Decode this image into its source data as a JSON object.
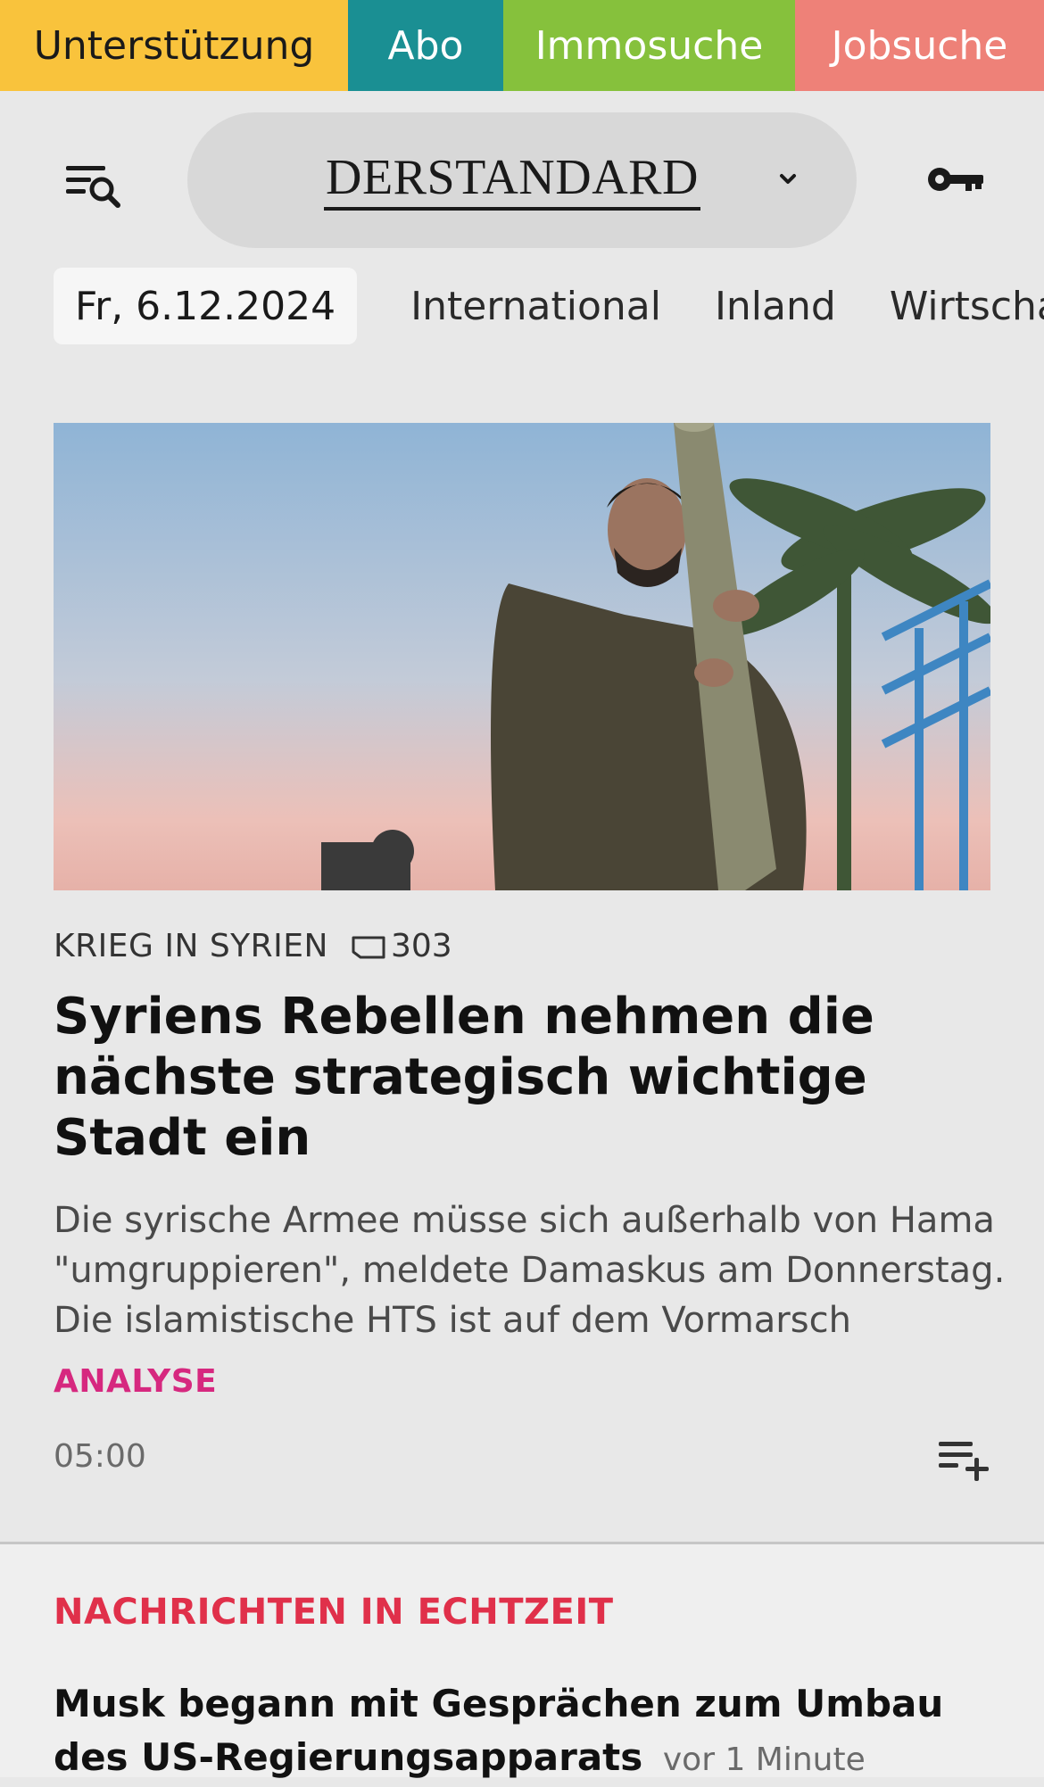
{
  "topbar": {
    "support": "Unterstützung",
    "abo": "Abo",
    "immo": "Immosuche",
    "jobs": "Jobsuche"
  },
  "header": {
    "brand": "DERSTANDARD",
    "menu_icon": "menu-search-icon",
    "chevron_icon": "chevron-down-icon",
    "login_icon": "key-icon"
  },
  "nav": {
    "date": "Fr, 6.12.2024",
    "sections": [
      "International",
      "Inland",
      "Wirtschaft"
    ]
  },
  "article": {
    "kicker": "KRIEG IN SYRIEN",
    "comments": "303",
    "headline": "Syriens Rebellen nehmen die nächste strategisch wichtige Stadt ein",
    "teaser": "Die syrische Armee müsse sich außerhalb von Hama \"umgruppieren\", meldete Damaskus am Donnerstag. Die islamistische HTS ist auf dem Vormarsch",
    "label": "ANALYSE",
    "time": "05:00"
  },
  "live": {
    "title": "NACHRICHTEN IN ECHTZEIT",
    "items": [
      {
        "headline": "Musk begann mit Gesprächen zum Umbau des US-Regierungsapparats",
        "time": "vor 1 Minute"
      }
    ]
  },
  "colors": {
    "support": "#f9c33c",
    "abo": "#1a8f93",
    "immo": "#86c13c",
    "jobs": "#ee8178",
    "analyse": "#d6287f",
    "live": "#e0304a"
  }
}
